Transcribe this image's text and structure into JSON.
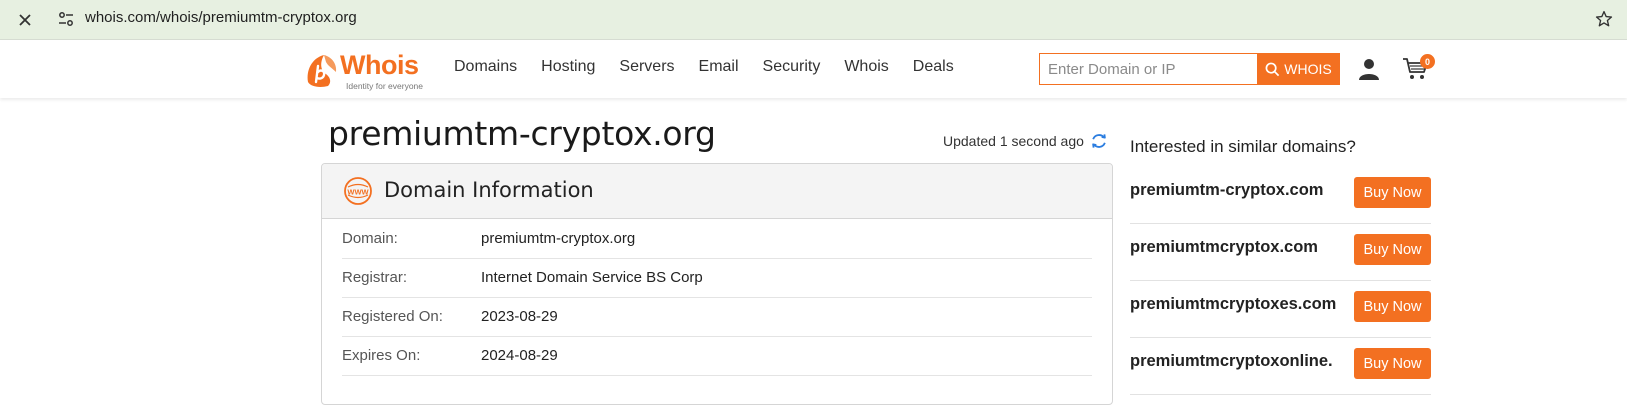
{
  "browser": {
    "url": "whois.com/whois/premiumtm-cryptox.org",
    "icons": [
      "close-icon",
      "site-info-icon",
      "star-icon"
    ]
  },
  "header": {
    "logo_text": "Whois",
    "logo_tagline": "Identity for everyone",
    "nav": [
      {
        "label": "Domains"
      },
      {
        "label": "Hosting"
      },
      {
        "label": "Servers"
      },
      {
        "label": "Email"
      },
      {
        "label": "Security"
      },
      {
        "label": "Whois"
      },
      {
        "label": "Deals"
      }
    ],
    "search_placeholder": "Enter Domain or IP",
    "search_button": "WHOIS",
    "cart_count": "0",
    "accent_color": "#f37021"
  },
  "main": {
    "domain": "premiumtm-cryptox.org",
    "updated": "Updated 1 second ago",
    "card_title": "Domain Information",
    "rows": [
      {
        "label": "Domain:",
        "value": "premiumtm-cryptox.org"
      },
      {
        "label": "Registrar:",
        "value": "Internet Domain Service BS Corp"
      },
      {
        "label": "Registered On:",
        "value": "2023-08-29"
      },
      {
        "label": "Expires On:",
        "value": "2024-08-29"
      }
    ]
  },
  "sidebar": {
    "title": "Interested in similar domains?",
    "suggestions": [
      {
        "name": "premiumtm-cryptox.com",
        "button": "Buy Now"
      },
      {
        "name": "premiumtmcryptox.com",
        "button": "Buy Now"
      },
      {
        "name": "premiumtmcryptoxes.com",
        "button": "Buy Now"
      },
      {
        "name": "premiumtmcryptoxonline.",
        "button": "Buy Now"
      }
    ]
  }
}
